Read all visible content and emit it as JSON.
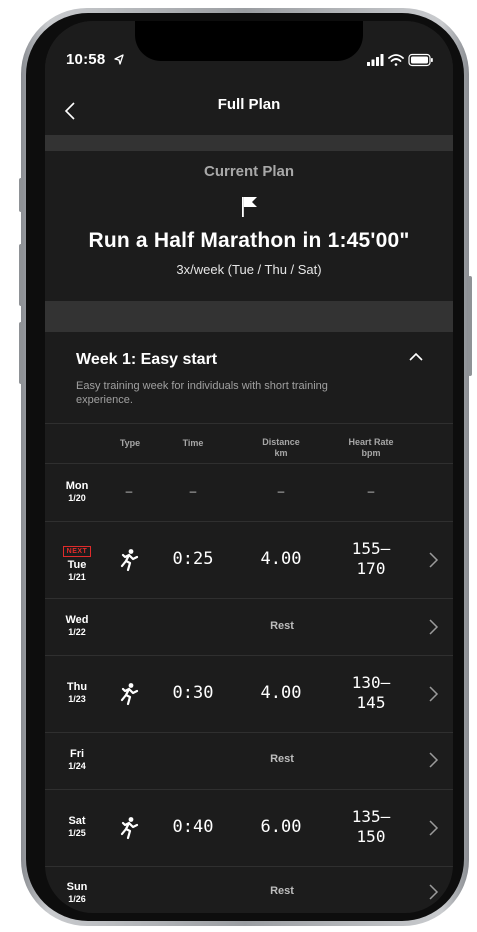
{
  "status_bar": {
    "time": "10:58"
  },
  "nav": {
    "title": "Full Plan"
  },
  "plan": {
    "label": "Current Plan",
    "title": "Run a Half Marathon in 1:45'00\"",
    "schedule": "3x/week (Tue / Thu / Sat)"
  },
  "week": {
    "title": "Week 1: Easy start",
    "description": "Easy training week for individuals with short training experience."
  },
  "table_headers": {
    "type": "Type",
    "time": "Time",
    "distance": "Distance",
    "distance_unit": "km",
    "heart_rate": "Heart Rate",
    "heart_rate_unit": "bpm"
  },
  "days": [
    {
      "day": "Mon",
      "date": "1/20",
      "type": "–",
      "time": "–",
      "distance": "–",
      "hr": "–"
    },
    {
      "day": "Tue",
      "date": "1/21",
      "badge": "NEXT",
      "type_icon": "running-icon",
      "time": "0:25",
      "distance": "4.00",
      "hr_top": "155–",
      "hr_bottom": "170"
    },
    {
      "day": "Wed",
      "date": "1/22",
      "rest": "Rest"
    },
    {
      "day": "Thu",
      "date": "1/23",
      "type_icon": "running-icon",
      "time": "0:30",
      "distance": "4.00",
      "hr_top": "130–",
      "hr_bottom": "145"
    },
    {
      "day": "Fri",
      "date": "1/24",
      "rest": "Rest"
    },
    {
      "day": "Sat",
      "date": "1/25",
      "type_icon": "running-icon",
      "time": "0:40",
      "distance": "6.00",
      "hr_top": "135–",
      "hr_bottom": "150"
    },
    {
      "day": "Sun",
      "date": "1/26",
      "rest": "Rest"
    }
  ],
  "colors": {
    "background": "#1c1c1c",
    "band": "#333333",
    "accent": "#e02b2b"
  }
}
